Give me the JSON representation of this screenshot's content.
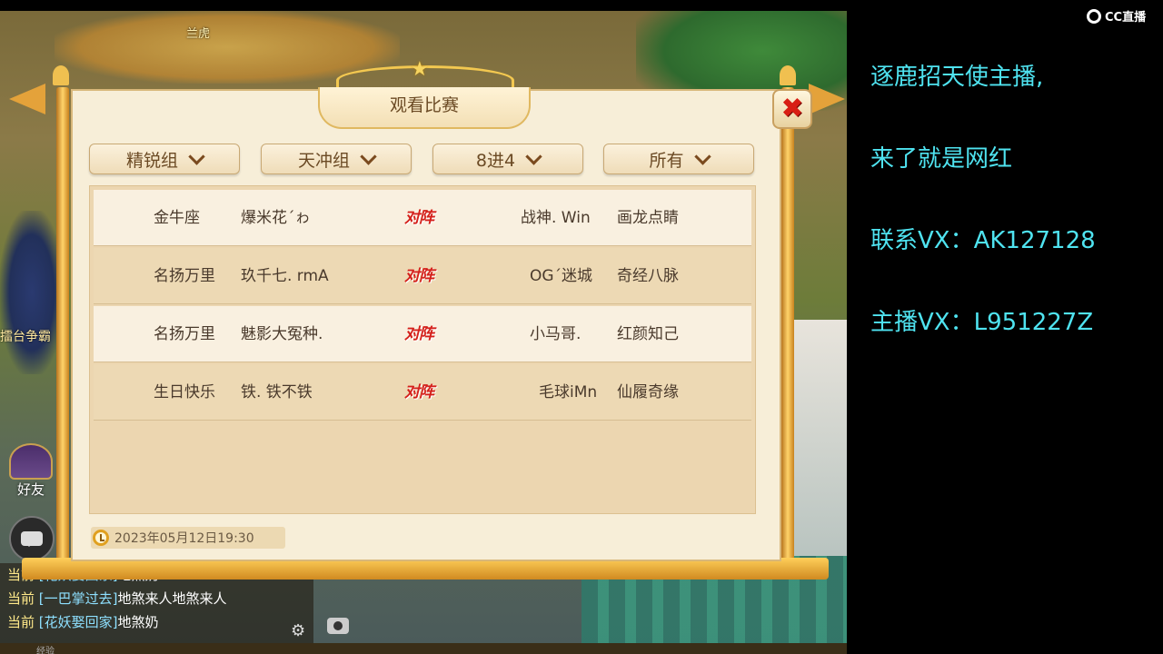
{
  "streamer": {
    "logo_text": "CC直播",
    "promo_lines": [
      "逐鹿招天使主播,",
      "来了就是网红",
      "联系VX：AK127128",
      "主播VX：L951227Z"
    ],
    "promo_color": "#4fe3f0"
  },
  "game": {
    "bg_label_top": "兰虎",
    "bg_label_side": "擂台争霸",
    "friend_label": "好友",
    "chat": [
      {
        "channel": "当前",
        "name": "[花妖娶回家]",
        "text": "地煞奶"
      },
      {
        "channel": "当前",
        "name": "[一巴掌过去]",
        "text": "地煞来人地煞来人"
      },
      {
        "channel": "当前",
        "name": "[花妖娶回家]",
        "text": "地煞奶"
      }
    ],
    "bottom_text": "经验"
  },
  "dialog": {
    "title": "观看比赛",
    "close_icon": "close-icon",
    "filters": {
      "group": "精锐组",
      "division": "天冲组",
      "round": "8进4",
      "scope": "所有"
    },
    "vs_label": "对阵",
    "matches": [
      {
        "left_team": "金牛座",
        "left_player": "爆米花´ゎ",
        "right_team": "战神. Win",
        "right_player": "画龙点睛"
      },
      {
        "left_team": "名扬万里",
        "left_player": "玖千七. rmA",
        "right_team": "OG´迷城",
        "right_player": "奇经八脉"
      },
      {
        "left_team": "名扬万里",
        "left_player": "魅影大冤种.",
        "right_team": "小马哥.",
        "right_player": "红颜知己"
      },
      {
        "left_team": "生日快乐",
        "left_player": "铁. 铁不铁",
        "right_team": "毛球iMn",
        "right_player": "仙履奇缘"
      }
    ],
    "timestamp": "2023年05月12日19:30"
  },
  "colors": {
    "vs_red": "#d4201a",
    "paper": "#f7eed8",
    "gold": "#e4a23a"
  }
}
